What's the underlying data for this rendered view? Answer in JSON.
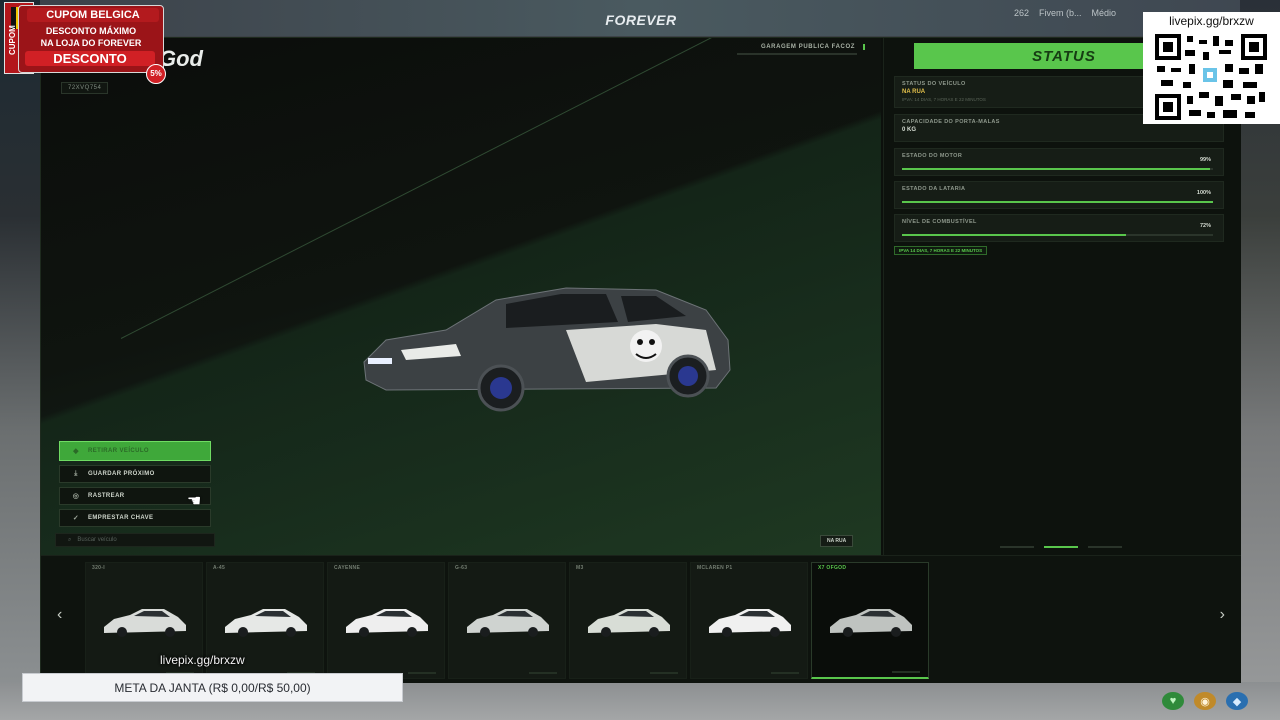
{
  "server": {
    "logo": "FOREVER"
  },
  "hud": {
    "players": "262",
    "name": "Fivem (b...",
    "ping": "Médio"
  },
  "garage": {
    "brand": "God",
    "plate": "72XVQ754",
    "name": "GARAGEM PUBLICA FACOZ",
    "actions": [
      {
        "label": "RETIRAR VEÍCULO",
        "icon": "car-out-icon"
      },
      {
        "label": "GUARDAR PRÓXIMO",
        "icon": "download-icon"
      },
      {
        "label": "RASTREAR",
        "icon": "target-icon"
      },
      {
        "label": "EMPRESTAR CHAVE",
        "icon": "key-icon"
      }
    ],
    "search_placeholder": "Buscar veículo",
    "location_tag": "NA RUA"
  },
  "status": {
    "title": "STATUS",
    "vehicle_status_label": "STATUS DO VEÍCULO",
    "vehicle_status_value": "NA RUA",
    "vehicle_status_sub": "IPVA: 14 DIAS, 7 HORAS E 22 MINUTOS",
    "trunk_label": "CAPACIDADE DO PORTA-MALAS",
    "trunk_value": "0 KG",
    "engine_label": "ESTADO DO MOTOR",
    "engine_pct": "99%",
    "engine_value": 0.99,
    "body_label": "ESTADO DA LATARIA",
    "body_pct": "100%",
    "body_value": 1.0,
    "fuel_label": "NÍVEL DE COMBUSTÍVEL",
    "fuel_pct": "72%",
    "fuel_value": 0.72,
    "ipva": "IPVA 14 DIAS, 7 HORAS E 22 MINUTOS"
  },
  "vehicles": [
    {
      "name": "320-I",
      "color": "#d9dcd9",
      "active": false
    },
    {
      "name": "A-45",
      "color": "#e6e8e6",
      "active": false
    },
    {
      "name": "CAYENNE",
      "color": "#eeeeee",
      "active": false
    },
    {
      "name": "G-63",
      "color": "#cfd3d0",
      "active": false
    },
    {
      "name": "M3",
      "color": "#d8ddd6",
      "active": false
    },
    {
      "name": "MCLAREN P1",
      "color": "#f0f0f0",
      "active": false
    },
    {
      "name": "X7 OFGOD",
      "color": "#bfc3c0",
      "active": true
    }
  ],
  "overlay": {
    "promo_title": "CUPOM BELGICA",
    "promo_line2": "DESCONTO MÁXIMO",
    "promo_line3": "NA LOJA DO FOREVER",
    "promo_cta": "DESCONTO",
    "promo_side": "CUPOM",
    "promo_badge": "5%",
    "qr_label": "livepix.gg/brxzw",
    "watermark": "livepix.gg/brxzw",
    "goal": "META DA JANTA (R$ 0,00/R$ 50,00)"
  },
  "colors": {
    "accent": "#59c64c",
    "warning": "#e3c04b",
    "promo": "#9b1418"
  }
}
